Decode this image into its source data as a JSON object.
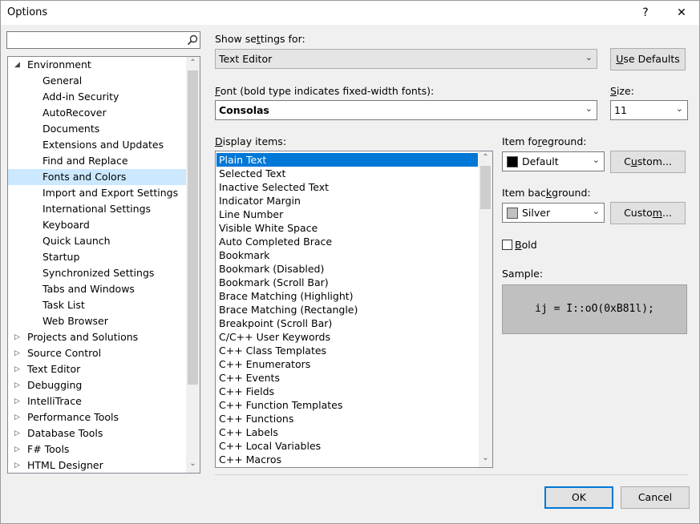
{
  "window": {
    "title": "Options",
    "help_label": "?",
    "close_label": "✕"
  },
  "search": {
    "value": "",
    "placeholder": ""
  },
  "tree": {
    "items": [
      {
        "label": "Environment",
        "expanded": true
      },
      {
        "label": "General"
      },
      {
        "label": "Add-in Security"
      },
      {
        "label": "AutoRecover"
      },
      {
        "label": "Documents"
      },
      {
        "label": "Extensions and Updates"
      },
      {
        "label": "Find and Replace"
      },
      {
        "label": "Fonts and Colors",
        "selected": true
      },
      {
        "label": "Import and Export Settings"
      },
      {
        "label": "International Settings"
      },
      {
        "label": "Keyboard"
      },
      {
        "label": "Quick Launch"
      },
      {
        "label": "Startup"
      },
      {
        "label": "Synchronized Settings"
      },
      {
        "label": "Tabs and Windows"
      },
      {
        "label": "Task List"
      },
      {
        "label": "Web Browser"
      },
      {
        "label": "Projects and Solutions",
        "expanded": false
      },
      {
        "label": "Source Control",
        "expanded": false
      },
      {
        "label": "Text Editor",
        "expanded": false
      },
      {
        "label": "Debugging",
        "expanded": false
      },
      {
        "label": "IntelliTrace",
        "expanded": false
      },
      {
        "label": "Performance Tools",
        "expanded": false
      },
      {
        "label": "Database Tools",
        "expanded": false
      },
      {
        "label": "F# Tools",
        "expanded": false
      },
      {
        "label": "HTML Designer",
        "expanded": false
      }
    ]
  },
  "settings": {
    "show_settings_for_label_pre": "Show se",
    "show_settings_for_label_key": "t",
    "show_settings_for_label_post": "tings for:",
    "show_settings_for_value": "Text Editor",
    "use_defaults_key": "U",
    "use_defaults_rest": "se Defaults",
    "font_label_key": "F",
    "font_label_rest": "ont (bold type indicates fixed-width fonts):",
    "font_value": "Consolas",
    "size_label_key": "S",
    "size_label_rest": "ize:",
    "size_value": "11"
  },
  "display_items": {
    "label_key": "D",
    "label_rest": "isplay items:",
    "items": [
      "Plain Text",
      "Selected Text",
      "Inactive Selected Text",
      "Indicator Margin",
      "Line Number",
      "Visible White Space",
      "Auto Completed Brace",
      "Bookmark",
      "Bookmark (Disabled)",
      "Bookmark (Scroll Bar)",
      "Brace Matching (Highlight)",
      "Brace Matching (Rectangle)",
      "Breakpoint (Scroll Bar)",
      "C/C++ User Keywords",
      "C++ Class Templates",
      "C++ Enumerators",
      "C++ Events",
      "C++ Fields",
      "C++ Function Templates",
      "C++ Functions",
      "C++ Labels",
      "C++ Local Variables",
      "C++ Macros"
    ],
    "selected_index": 0
  },
  "foreground": {
    "label_pre": "Item fo",
    "label_key": "r",
    "label_post": "eground:",
    "value": "Default",
    "swatch_color": "#000000",
    "custom_pre": "C",
    "custom_key": "u",
    "custom_post": "stom..."
  },
  "background": {
    "label_pre": "Item bac",
    "label_key": "k",
    "label_post": "ground:",
    "value": "Silver",
    "swatch_color": "#c0c0c0",
    "custom_pre": "Custo",
    "custom_key": "m",
    "custom_post": "..."
  },
  "bold": {
    "key": "B",
    "rest": "old",
    "checked": false
  },
  "sample": {
    "label": "Sample:",
    "text": "ij = I::oO(0xB81l);"
  },
  "buttons": {
    "ok": "OK",
    "cancel": "Cancel"
  },
  "colors": {
    "selection": "#0078d7",
    "tree_selection": "#cce8ff",
    "accent_border": "#0078d7"
  }
}
